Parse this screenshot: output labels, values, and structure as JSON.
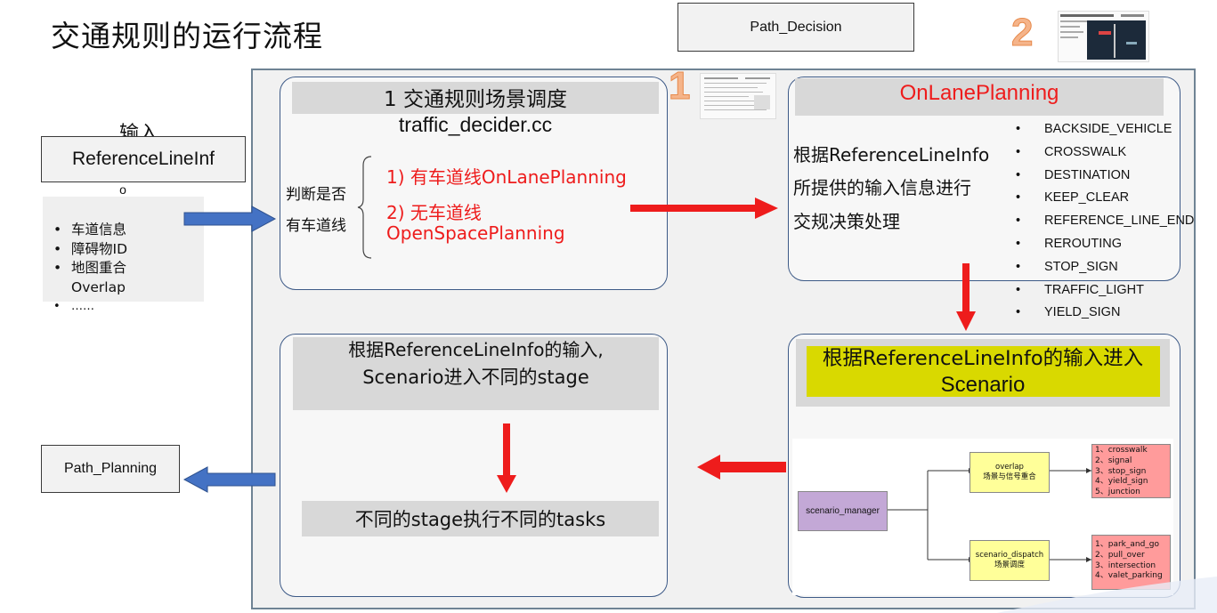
{
  "title": "交通规则的运行流程",
  "path_decision": "Path_Decision",
  "marker_1": "1",
  "marker_2": "2",
  "input": {
    "label": "输入",
    "ref_line_1": "ReferenceLineInf",
    "ref_line_2": "o",
    "items": [
      "车道信息",
      "障碍物ID",
      "地图重合 Overlap",
      "……"
    ]
  },
  "box1": {
    "title": "1 交通规则场景调度",
    "file": "traffic_decider.cc",
    "judge_1": "判断是否",
    "judge_2": "有车道线",
    "opt1": "1) 有车道线OnLanePlanning",
    "opt2_1": "2) 无车道线",
    "opt2_2": "OpenSpacePlanning"
  },
  "box2": {
    "title": "OnLanePlanning",
    "desc_1": "根据ReferenceLineInfo",
    "desc_2": "所提供的输入信息进行",
    "desc_3": "交规决策处理",
    "rules": [
      "BACKSIDE_VEHICLE",
      "CROSSWALK",
      "DESTINATION",
      "KEEP_CLEAR",
      "REFERENCE_LINE_END",
      "REROUTING",
      "STOP_SIGN",
      "TRAFFIC_LIGHT",
      "YIELD_SIGN"
    ]
  },
  "box3": {
    "title_1": "根据ReferenceLineInfo的输入进入",
    "title_2": "Scenario",
    "manager": "scenario_manager",
    "overlap_1": "overlap",
    "overlap_2": "场景与信号重合",
    "dispatch_1": "scenario_dispatch",
    "dispatch_2": "场景调度",
    "overlap_items": [
      "1、crosswalk",
      "2、signal",
      "3、stop_sign",
      "4、yield_sign",
      "5、junction"
    ],
    "dispatch_items": [
      "1、park_and_go",
      "2、pull_over",
      "3、intersection",
      "4、valet_parking"
    ]
  },
  "box4": {
    "title_1": "根据ReferenceLineInfo的输入,",
    "title_2": "Scenario进入不同的stage",
    "bottom": "不同的stage执行不同的tasks"
  },
  "path_planning": "Path_Planning",
  "colors": {
    "red": "#ee1c1c",
    "blue_arrow": "#4472c4",
    "yellow_band": "#d9d900",
    "border_blue": "#3d5a87"
  }
}
